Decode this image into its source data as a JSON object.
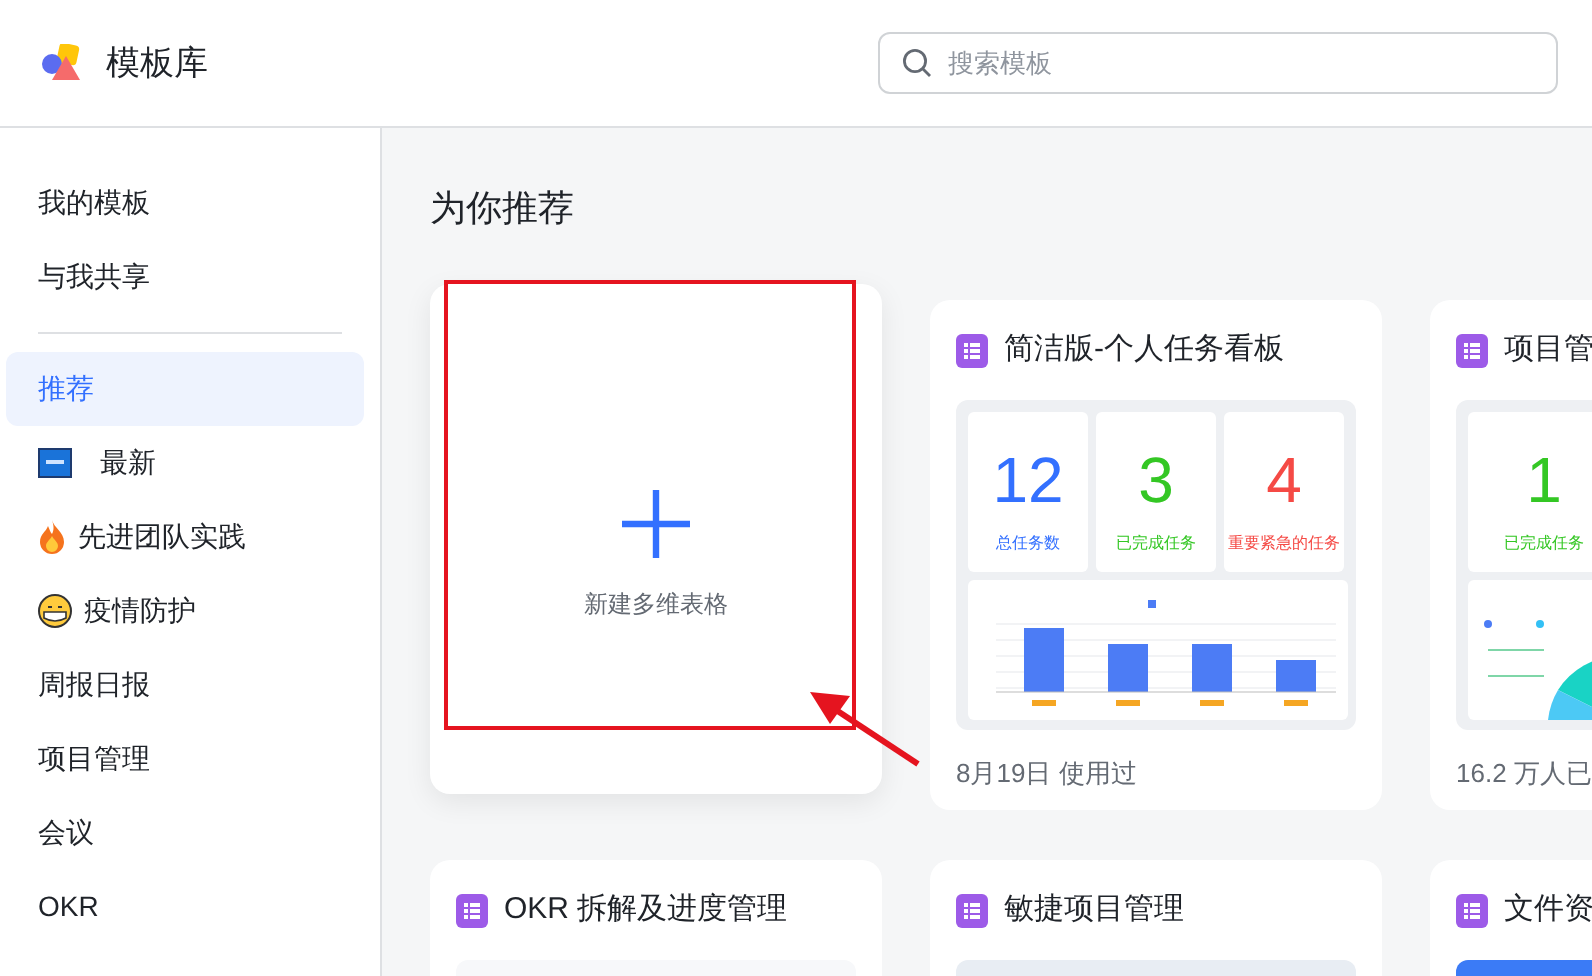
{
  "header": {
    "title": "模板库",
    "search": {
      "placeholder": "搜索模板"
    }
  },
  "sidebar": {
    "personal": [
      {
        "label": "我的模板",
        "selected": false
      },
      {
        "label": "与我共享",
        "selected": false
      }
    ],
    "categories": [
      {
        "label": "推荐",
        "selected": true,
        "kind": "plain"
      },
      {
        "label": "最新",
        "selected": false,
        "kind": "news"
      },
      {
        "label": "先进团队实践",
        "selected": false,
        "kind": "fire"
      },
      {
        "label": "疫情防护",
        "selected": false,
        "kind": "mask"
      },
      {
        "label": "周报日报",
        "selected": false,
        "kind": "plain"
      },
      {
        "label": "项目管理",
        "selected": false,
        "kind": "plain"
      },
      {
        "label": "会议",
        "selected": false,
        "kind": "plain"
      },
      {
        "label": "OKR",
        "selected": false,
        "kind": "plain"
      }
    ]
  },
  "main": {
    "title": "为你推荐",
    "new_card": {
      "label": "新建多维表格"
    },
    "cards": [
      {
        "title": "简洁版-个人任务看板",
        "footer": "8月19日 使用过",
        "preview": {
          "kind": "dashboard",
          "stats": [
            {
              "value": "12",
              "label": "总任务数",
              "color": "#3370ff"
            },
            {
              "value": "3",
              "label": "已完成任务",
              "color": "#34c724"
            },
            {
              "value": "4",
              "label": "重要紧急的任务",
              "color": "#f54a45"
            }
          ]
        }
      },
      {
        "title": "项目管",
        "footer": "16.2 万人已",
        "preview": {
          "kind": "pie",
          "stats": [
            {
              "value": "1",
              "label": "已完成任务",
              "color": "#34c724"
            }
          ]
        }
      },
      {
        "title": "OKR 拆解及进度管理",
        "preview": {
          "kind": "doc"
        }
      },
      {
        "title": "敏捷项目管理",
        "preview": {
          "kind": "split"
        }
      },
      {
        "title": "文件资",
        "preview": {
          "kind": "blue"
        }
      }
    ]
  }
}
